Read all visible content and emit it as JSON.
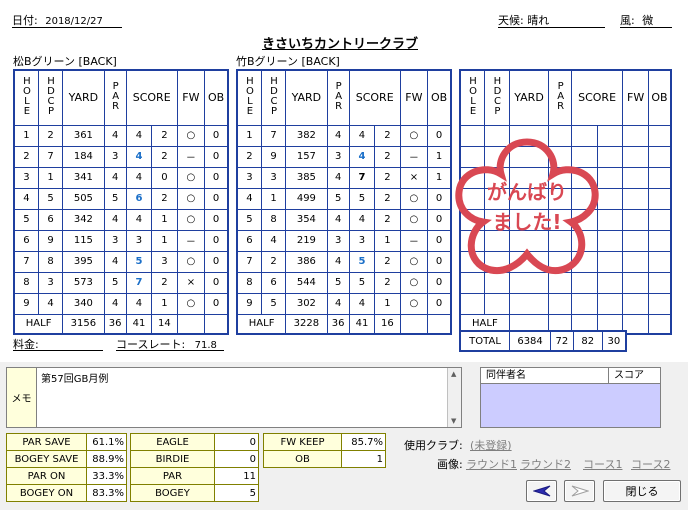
{
  "header": {
    "date_label": "日付:",
    "date": "2018/12/27",
    "weather_label": "天候:",
    "weather": "晴れ",
    "wind_label": "風:",
    "wind": "微",
    "club_name": "きさいちカントリークラブ"
  },
  "columns": {
    "hole": "HOLE",
    "hdcp": "HDCP",
    "yard": "YARD",
    "par": "PAR",
    "score": "SCORE",
    "fw": "FW",
    "ob": "OB",
    "half": "HALF",
    "total": "TOTAL"
  },
  "out": {
    "course": "松Bグリーン [BACK]",
    "rows": [
      {
        "hole": "1",
        "hdcp": "2",
        "yard": "361",
        "par": "4",
        "score": "4",
        "putts": "2",
        "fw": "○",
        "ob": "0",
        "blue": false
      },
      {
        "hole": "2",
        "hdcp": "7",
        "yard": "184",
        "par": "3",
        "score": "4",
        "putts": "2",
        "fw": "－",
        "ob": "0",
        "blue": true
      },
      {
        "hole": "3",
        "hdcp": "1",
        "yard": "341",
        "par": "4",
        "score": "4",
        "putts": "0",
        "fw": "○",
        "ob": "0",
        "blue": false
      },
      {
        "hole": "4",
        "hdcp": "5",
        "yard": "505",
        "par": "5",
        "score": "6",
        "putts": "2",
        "fw": "○",
        "ob": "0",
        "blue": true
      },
      {
        "hole": "5",
        "hdcp": "6",
        "yard": "342",
        "par": "4",
        "score": "4",
        "putts": "1",
        "fw": "○",
        "ob": "0",
        "blue": false
      },
      {
        "hole": "6",
        "hdcp": "9",
        "yard": "115",
        "par": "3",
        "score": "3",
        "putts": "1",
        "fw": "－",
        "ob": "0",
        "blue": false
      },
      {
        "hole": "7",
        "hdcp": "8",
        "yard": "395",
        "par": "4",
        "score": "5",
        "putts": "3",
        "fw": "○",
        "ob": "0",
        "blue": true
      },
      {
        "hole": "8",
        "hdcp": "3",
        "yard": "573",
        "par": "5",
        "score": "7",
        "putts": "2",
        "fw": "×",
        "ob": "0",
        "blue": true
      },
      {
        "hole": "9",
        "hdcp": "4",
        "yard": "340",
        "par": "4",
        "score": "4",
        "putts": "1",
        "fw": "○",
        "ob": "0",
        "blue": false
      }
    ],
    "half": {
      "yard": "3156",
      "par": "36",
      "score": "41",
      "putts": "14"
    }
  },
  "in": {
    "course": "竹Bグリーン [BACK]",
    "rows": [
      {
        "hole": "1",
        "hdcp": "7",
        "yard": "382",
        "par": "4",
        "score": "4",
        "putts": "2",
        "fw": "○",
        "ob": "0",
        "blue": false
      },
      {
        "hole": "2",
        "hdcp": "9",
        "yard": "157",
        "par": "3",
        "score": "4",
        "putts": "2",
        "fw": "－",
        "ob": "1",
        "blue": true
      },
      {
        "hole": "3",
        "hdcp": "3",
        "yard": "385",
        "par": "4",
        "score": "7",
        "putts": "2",
        "fw": "×",
        "ob": "1",
        "blue": false
      },
      {
        "hole": "4",
        "hdcp": "1",
        "yard": "499",
        "par": "5",
        "score": "5",
        "putts": "2",
        "fw": "○",
        "ob": "0",
        "blue": false
      },
      {
        "hole": "5",
        "hdcp": "8",
        "yard": "354",
        "par": "4",
        "score": "4",
        "putts": "2",
        "fw": "○",
        "ob": "0",
        "blue": false
      },
      {
        "hole": "6",
        "hdcp": "4",
        "yard": "219",
        "par": "3",
        "score": "3",
        "putts": "1",
        "fw": "－",
        "ob": "0",
        "blue": false
      },
      {
        "hole": "7",
        "hdcp": "2",
        "yard": "386",
        "par": "4",
        "score": "5",
        "putts": "2",
        "fw": "○",
        "ob": "0",
        "blue": true
      },
      {
        "hole": "8",
        "hdcp": "6",
        "yard": "544",
        "par": "5",
        "score": "5",
        "putts": "2",
        "fw": "○",
        "ob": "0",
        "blue": false
      },
      {
        "hole": "9",
        "hdcp": "5",
        "yard": "302",
        "par": "4",
        "score": "4",
        "putts": "1",
        "fw": "○",
        "ob": "0",
        "blue": false
      }
    ],
    "half": {
      "yard": "3228",
      "par": "36",
      "score": "41",
      "putts": "16"
    }
  },
  "total": {
    "yard": "6384",
    "par": "72",
    "score": "82",
    "putts": "30"
  },
  "stamp": {
    "line1": "がんばり",
    "line2": "ました!",
    "color": "#d94853"
  },
  "fee_label": "料金:",
  "course_rate_label": "コースレート:",
  "course_rate": "71.8",
  "memo": {
    "label": "メモ",
    "text": "第57回GB月例"
  },
  "companions": {
    "name_header": "同伴者名",
    "score_header": "スコア"
  },
  "stats_left": [
    {
      "label": "PAR SAVE",
      "value": "61.1%"
    },
    {
      "label": "BOGEY SAVE",
      "value": "88.9%"
    },
    {
      "label": "PAR ON",
      "value": "33.3%"
    },
    {
      "label": "BOGEY ON",
      "value": "83.3%"
    }
  ],
  "stats_mid": [
    {
      "label": "EAGLE",
      "value": "0"
    },
    {
      "label": "BIRDIE",
      "value": "0"
    },
    {
      "label": "PAR",
      "value": "11"
    },
    {
      "label": "BOGEY",
      "value": "5"
    }
  ],
  "stats_right": [
    {
      "label": "FW KEEP",
      "value": "85.7%"
    },
    {
      "label": "OB",
      "value": "1"
    }
  ],
  "club": {
    "label": "使用クラブ:",
    "value": "(未登録)"
  },
  "images": {
    "label": "画像:",
    "links": [
      "ラウンド1",
      "ラウンド2",
      "コース1",
      "コース2"
    ]
  },
  "buttons": {
    "close": "閉じる"
  },
  "colors": {
    "grid": "#1f3f9f",
    "highlight": "#1b6fc8",
    "label_bg": "#ffffdc",
    "companion_bg": "#ccccff"
  }
}
